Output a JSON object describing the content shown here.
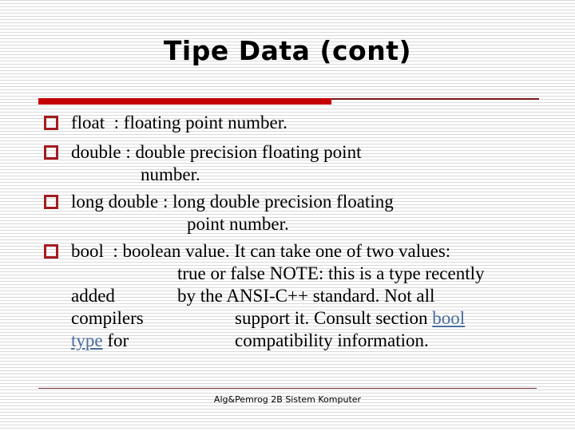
{
  "slide": {
    "title": "Tipe Data (cont)",
    "accent_color": "#c40000",
    "bullet_color": "#a11c20",
    "bullets": [
      {
        "lines": [
          "float  : floating point number."
        ]
      },
      {
        "lines": [
          "double : double precision floating point",
          "number."
        ]
      },
      {
        "lines": [
          "long double : long double precision floating",
          "point number."
        ]
      },
      {
        "lines": [
          "bool  : boolean value. It can take one of two values:",
          "true or false NOTE: this is a type recently",
          "added",
          "by the ANSI-C++ standard. Not all",
          "compilers",
          "support it. Consult section ",
          "bool",
          "type",
          " for",
          "compatibility information."
        ],
        "link_text": "bool type"
      }
    ],
    "footer": "Alg&Pemrog 2B Sistem Komputer"
  }
}
